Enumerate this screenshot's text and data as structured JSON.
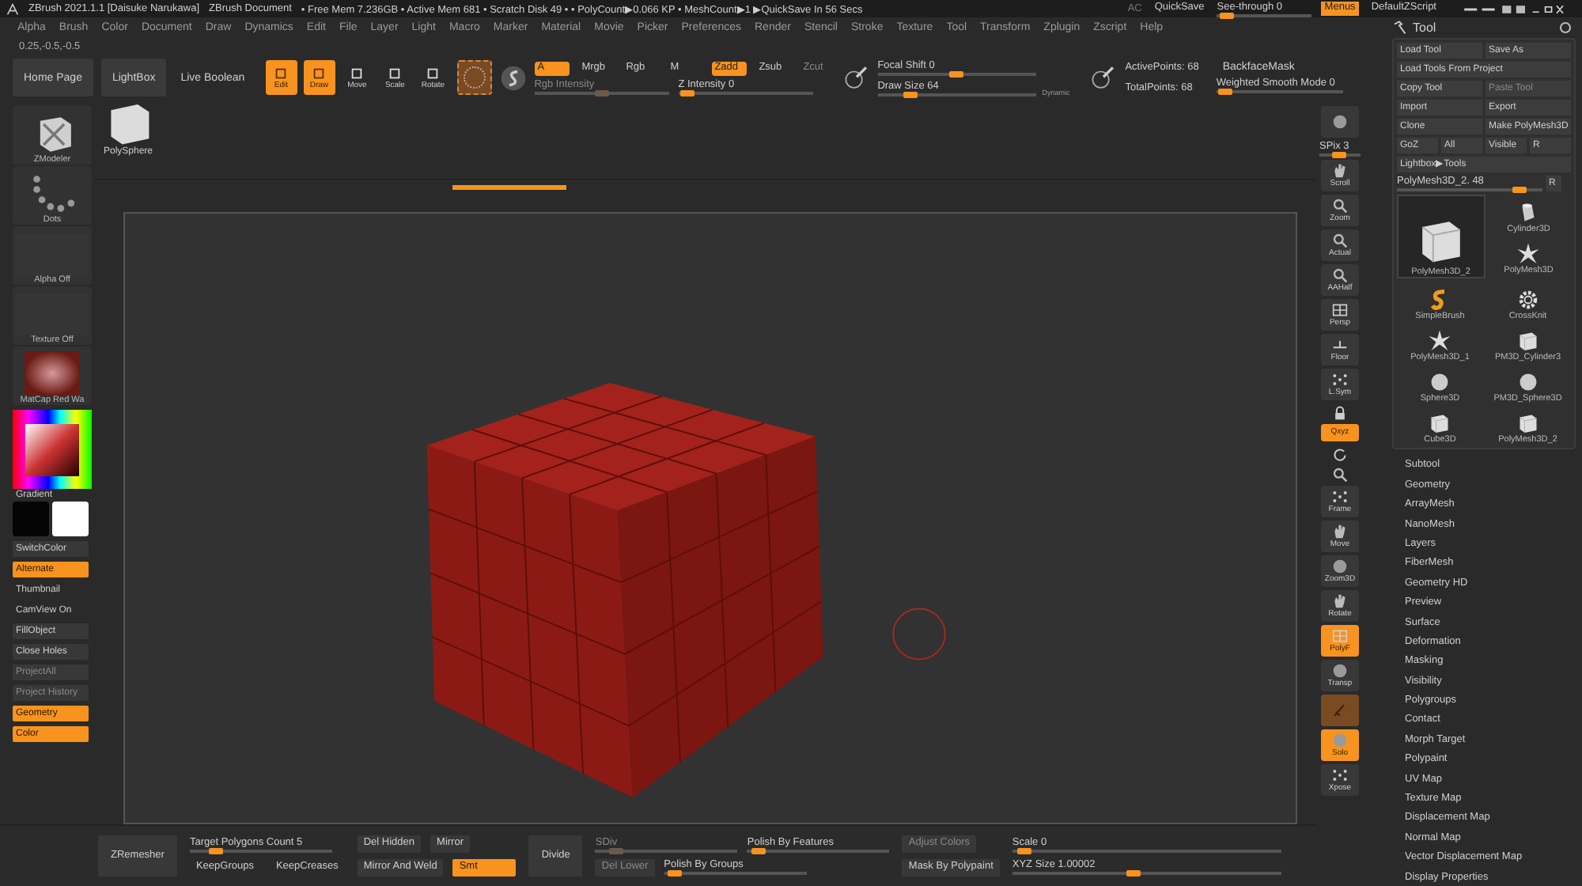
{
  "title_bar": {
    "app_title": "ZBrush 2021.1.1 [Daisuke Narukawa]",
    "document": "ZBrush Document",
    "status": "• Free Mem 7.236GB • Active Mem 681 • Scratch Disk 49 • • PolyCount▶0.066 KP • MeshCount▶1 ▶QuickSave In 56 Secs",
    "ac": "AC",
    "quicksave": "QuickSave",
    "see_through": {
      "label": "See-through 0",
      "level": 0.03
    },
    "menus": {
      "label": "Menus",
      "on": true
    },
    "script": "DefaultZScript"
  },
  "menu_bar": [
    "Alpha",
    "Brush",
    "Color",
    "Document",
    "Draw",
    "Dynamics",
    "Edit",
    "File",
    "Layer",
    "Light",
    "Macro",
    "Marker",
    "Material",
    "Movie",
    "Picker",
    "Preferences",
    "Render",
    "Stencil",
    "Stroke",
    "Texture",
    "Tool",
    "Transform",
    "Zplugin",
    "Zscript",
    "Help"
  ],
  "coords": "0.25,-0.5,-0.5",
  "toolbar": {
    "home_page": "Home Page",
    "lightbox": "LightBox",
    "live_boolean": "Live Boolean",
    "modes": [
      {
        "label": "Edit",
        "on": true
      },
      {
        "label": "Draw",
        "on": true
      },
      {
        "label": "Move",
        "on": false
      },
      {
        "label": "Scale",
        "on": false
      },
      {
        "label": "Rotate",
        "on": false
      }
    ],
    "channels": [
      {
        "label": "A",
        "on": true,
        "disabled": false
      },
      {
        "label": "Mrgb",
        "on": false,
        "disabled": false
      },
      {
        "label": "Rgb",
        "on": false,
        "disabled": false
      },
      {
        "label": "M",
        "on": false,
        "disabled": false
      },
      {
        "label": "Zadd",
        "on": true,
        "disabled": false
      },
      {
        "label": "Zsub",
        "on": false,
        "disabled": false
      },
      {
        "label": "Zcut",
        "on": false,
        "disabled": true
      }
    ],
    "rgb_intensity": {
      "label": "Rgb Intensity",
      "level": 0.5,
      "disabled": true
    },
    "z_intensity": {
      "label": "Z Intensity 0",
      "level": 0.02,
      "disabled": false
    },
    "focal_shift": {
      "label": "Focal Shift 0",
      "level": 0.5,
      "disabled": false
    },
    "draw_size": {
      "label": "Draw Size 64",
      "level": 0.18,
      "disabled": false
    },
    "dynamic": "Dynamic",
    "active_points": "ActivePoints: 68",
    "total_points": "TotalPoints: 68",
    "backface_mask": "BackfaceMask",
    "weighted_smooth": {
      "label": "Weighted Smooth Mode 0",
      "level": 0.02,
      "disabled": false
    }
  },
  "left_shelf": {
    "tiles": [
      {
        "label": "ZModeler",
        "kind": "brush"
      },
      {
        "label": "Dots",
        "kind": "stroke"
      },
      {
        "label": "Alpha Off",
        "kind": "empty"
      },
      {
        "label": "Texture Off",
        "kind": "empty"
      },
      {
        "label": "MatCap Red Wa",
        "kind": "material"
      }
    ],
    "gradient": "Gradient",
    "buttons": [
      {
        "label": "SwitchColor",
        "kind": "button",
        "on": false,
        "disabled": false
      },
      {
        "label": "Alternate",
        "kind": "button",
        "on": true,
        "disabled": false
      },
      {
        "label": "Thumbnail",
        "kind": "text",
        "on": false,
        "disabled": false
      },
      {
        "label": "CamView On",
        "kind": "text",
        "on": false,
        "disabled": false
      },
      {
        "label": "FillObject",
        "kind": "button",
        "on": false,
        "disabled": false
      },
      {
        "label": "Close Holes",
        "kind": "button",
        "on": false,
        "disabled": false
      },
      {
        "label": "ProjectAll",
        "kind": "button",
        "on": false,
        "disabled": true
      },
      {
        "label": "Project History",
        "kind": "button",
        "on": false,
        "disabled": true
      },
      {
        "label": "Geometry",
        "kind": "button",
        "on": true,
        "disabled": false
      },
      {
        "label": "Color",
        "kind": "button",
        "on": true,
        "disabled": false
      }
    ]
  },
  "canvas": {
    "recent_tool": "PolySphere"
  },
  "right_shelf": [
    {
      "kind": "button",
      "on": false
    },
    {
      "kind": "slider",
      "label": "SPix 3",
      "level": 0.45
    },
    {
      "kind": "button",
      "label": "Scroll",
      "on": false
    },
    {
      "kind": "button",
      "label": "Zoom",
      "on": false
    },
    {
      "kind": "button",
      "label": "Actual",
      "on": false
    },
    {
      "kind": "button",
      "label": "AAHalf",
      "on": false
    },
    {
      "kind": "button",
      "label": "Persp",
      "on": false
    },
    {
      "kind": "button",
      "label": "Floor",
      "on": false
    },
    {
      "kind": "button",
      "label": "L.Sym",
      "on": false
    },
    {
      "kind": "small",
      "on": false
    },
    {
      "kind": "small",
      "label": "Qxyz",
      "on": true
    },
    {
      "kind": "small",
      "on": false
    },
    {
      "kind": "small",
      "on": false
    },
    {
      "kind": "button",
      "label": "Frame",
      "on": false
    },
    {
      "kind": "button",
      "label": "Move",
      "on": false
    },
    {
      "kind": "button",
      "label": "Zoom3D",
      "on": false
    },
    {
      "kind": "button",
      "label": "Rotate",
      "on": false
    },
    {
      "kind": "button",
      "label": "PolyF",
      "on": true
    },
    {
      "kind": "button",
      "label": "Transp",
      "on": false
    },
    {
      "kind": "button",
      "on": true
    },
    {
      "kind": "button",
      "label": "Solo",
      "on": true
    },
    {
      "kind": "button",
      "label": "Xpose",
      "on": false
    }
  ],
  "tool_panel": {
    "title": "Tool",
    "button_rows": [
      [
        {
          "label": "Load Tool",
          "disabled": false
        },
        {
          "label": "Save As",
          "disabled": false
        }
      ],
      [
        {
          "label": "Load Tools From Project",
          "disabled": false
        }
      ],
      [
        {
          "label": "Copy Tool",
          "disabled": false
        },
        {
          "label": "Paste Tool",
          "disabled": true
        }
      ],
      [
        {
          "label": "Import",
          "disabled": false
        },
        {
          "label": "Export",
          "disabled": false
        }
      ],
      [
        {
          "label": "Clone",
          "disabled": false
        },
        {
          "label": "Make PolyMesh3D",
          "disabled": false
        }
      ],
      [
        {
          "label": "GoZ",
          "disabled": false
        },
        {
          "label": "All",
          "disabled": false
        },
        {
          "label": "Visible",
          "disabled": false
        },
        {
          "label": "R",
          "disabled": false
        }
      ],
      [
        {
          "label": "Lightbox▶Tools",
          "disabled": false
        }
      ]
    ],
    "current_tool": {
      "label": "PolyMesh3D_2. 48",
      "level": 0.88
    },
    "current_reset": "R",
    "tools": [
      {
        "label": "Cylinder3D",
        "selected": false
      },
      {
        "label": "PolyMesh3D_2",
        "selected": true
      },
      {
        "label": "PolyMesh3D",
        "selected": false
      },
      {
        "label": "SimpleBrush",
        "selected": false
      },
      {
        "label": "CrossKnit",
        "selected": false
      },
      {
        "label": "PolyMesh3D_1",
        "selected": false
      },
      {
        "label": "PM3D_Cylinder3",
        "selected": false
      },
      {
        "label": "Sphere3D",
        "selected": false
      },
      {
        "label": "PM3D_Sphere3D",
        "selected": false
      },
      {
        "label": "Cube3D",
        "selected": false
      },
      {
        "label": "PolyMesh3D_2",
        "selected": false
      }
    ],
    "subpalettes": [
      "Subtool",
      "Geometry",
      "ArrayMesh",
      "NanoMesh",
      "Layers",
      "FiberMesh",
      "Geometry HD",
      "Preview",
      "Surface",
      "Deformation",
      "Masking",
      "Visibility",
      "Polygroups",
      "Contact",
      "Morph Target",
      "Polypaint",
      "UV Map",
      "Texture Map",
      "Displacement Map",
      "Normal Map",
      "Vector Displacement Map",
      "Display Properties"
    ]
  },
  "bottom_bar": [
    [
      [
        {
          "kind": "tall",
          "label": "ZRemesher",
          "on": false,
          "disabled": false
        }
      ]
    ],
    [
      [
        {
          "kind": "slider",
          "label": "Target Polygons Count 5",
          "level": 0.15,
          "disabled": false
        }
      ],
      [
        {
          "kind": "text",
          "label": "KeepGroups",
          "on": false,
          "disabled": false
        },
        {
          "kind": "text",
          "label": "KeepCreases",
          "on": false,
          "disabled": false
        }
      ]
    ],
    [
      [
        {
          "kind": "button",
          "label": "Del Hidden",
          "on": false,
          "disabled": false
        },
        {
          "kind": "button",
          "label": "Mirror",
          "on": false,
          "disabled": false
        }
      ],
      [
        {
          "kind": "button",
          "label": "Mirror And Weld",
          "on": false,
          "disabled": false
        },
        {
          "kind": "button",
          "label": "Smt",
          "on": true,
          "disabled": false
        }
      ]
    ],
    [
      [
        {
          "kind": "tall",
          "label": "Divide",
          "on": false,
          "disabled": false
        }
      ]
    ],
    [
      [
        {
          "kind": "slider",
          "label": "SDiv",
          "level": 0.1,
          "disabled": true
        },
        {
          "kind": "slider",
          "label": "Polish By Features",
          "level": 0.03,
          "disabled": false
        }
      ],
      [
        {
          "kind": "button",
          "label": "Del Lower",
          "on": false,
          "disabled": true
        },
        {
          "kind": "slider",
          "label": "Polish By Groups",
          "level": 0.03,
          "disabled": false
        }
      ]
    ],
    [
      [
        {
          "kind": "button",
          "label": "Adjust Colors",
          "on": false,
          "disabled": true
        }
      ],
      [
        {
          "kind": "button",
          "label": "Mask By Polypaint",
          "on": false,
          "disabled": false
        }
      ]
    ],
    [
      [
        {
          "kind": "slider",
          "label": "Scale 0",
          "level": 0.02,
          "disabled": false
        }
      ],
      [
        {
          "kind": "slider",
          "label": "XYZ Size 1.00002",
          "level": 0.45,
          "disabled": false
        }
      ]
    ]
  ]
}
